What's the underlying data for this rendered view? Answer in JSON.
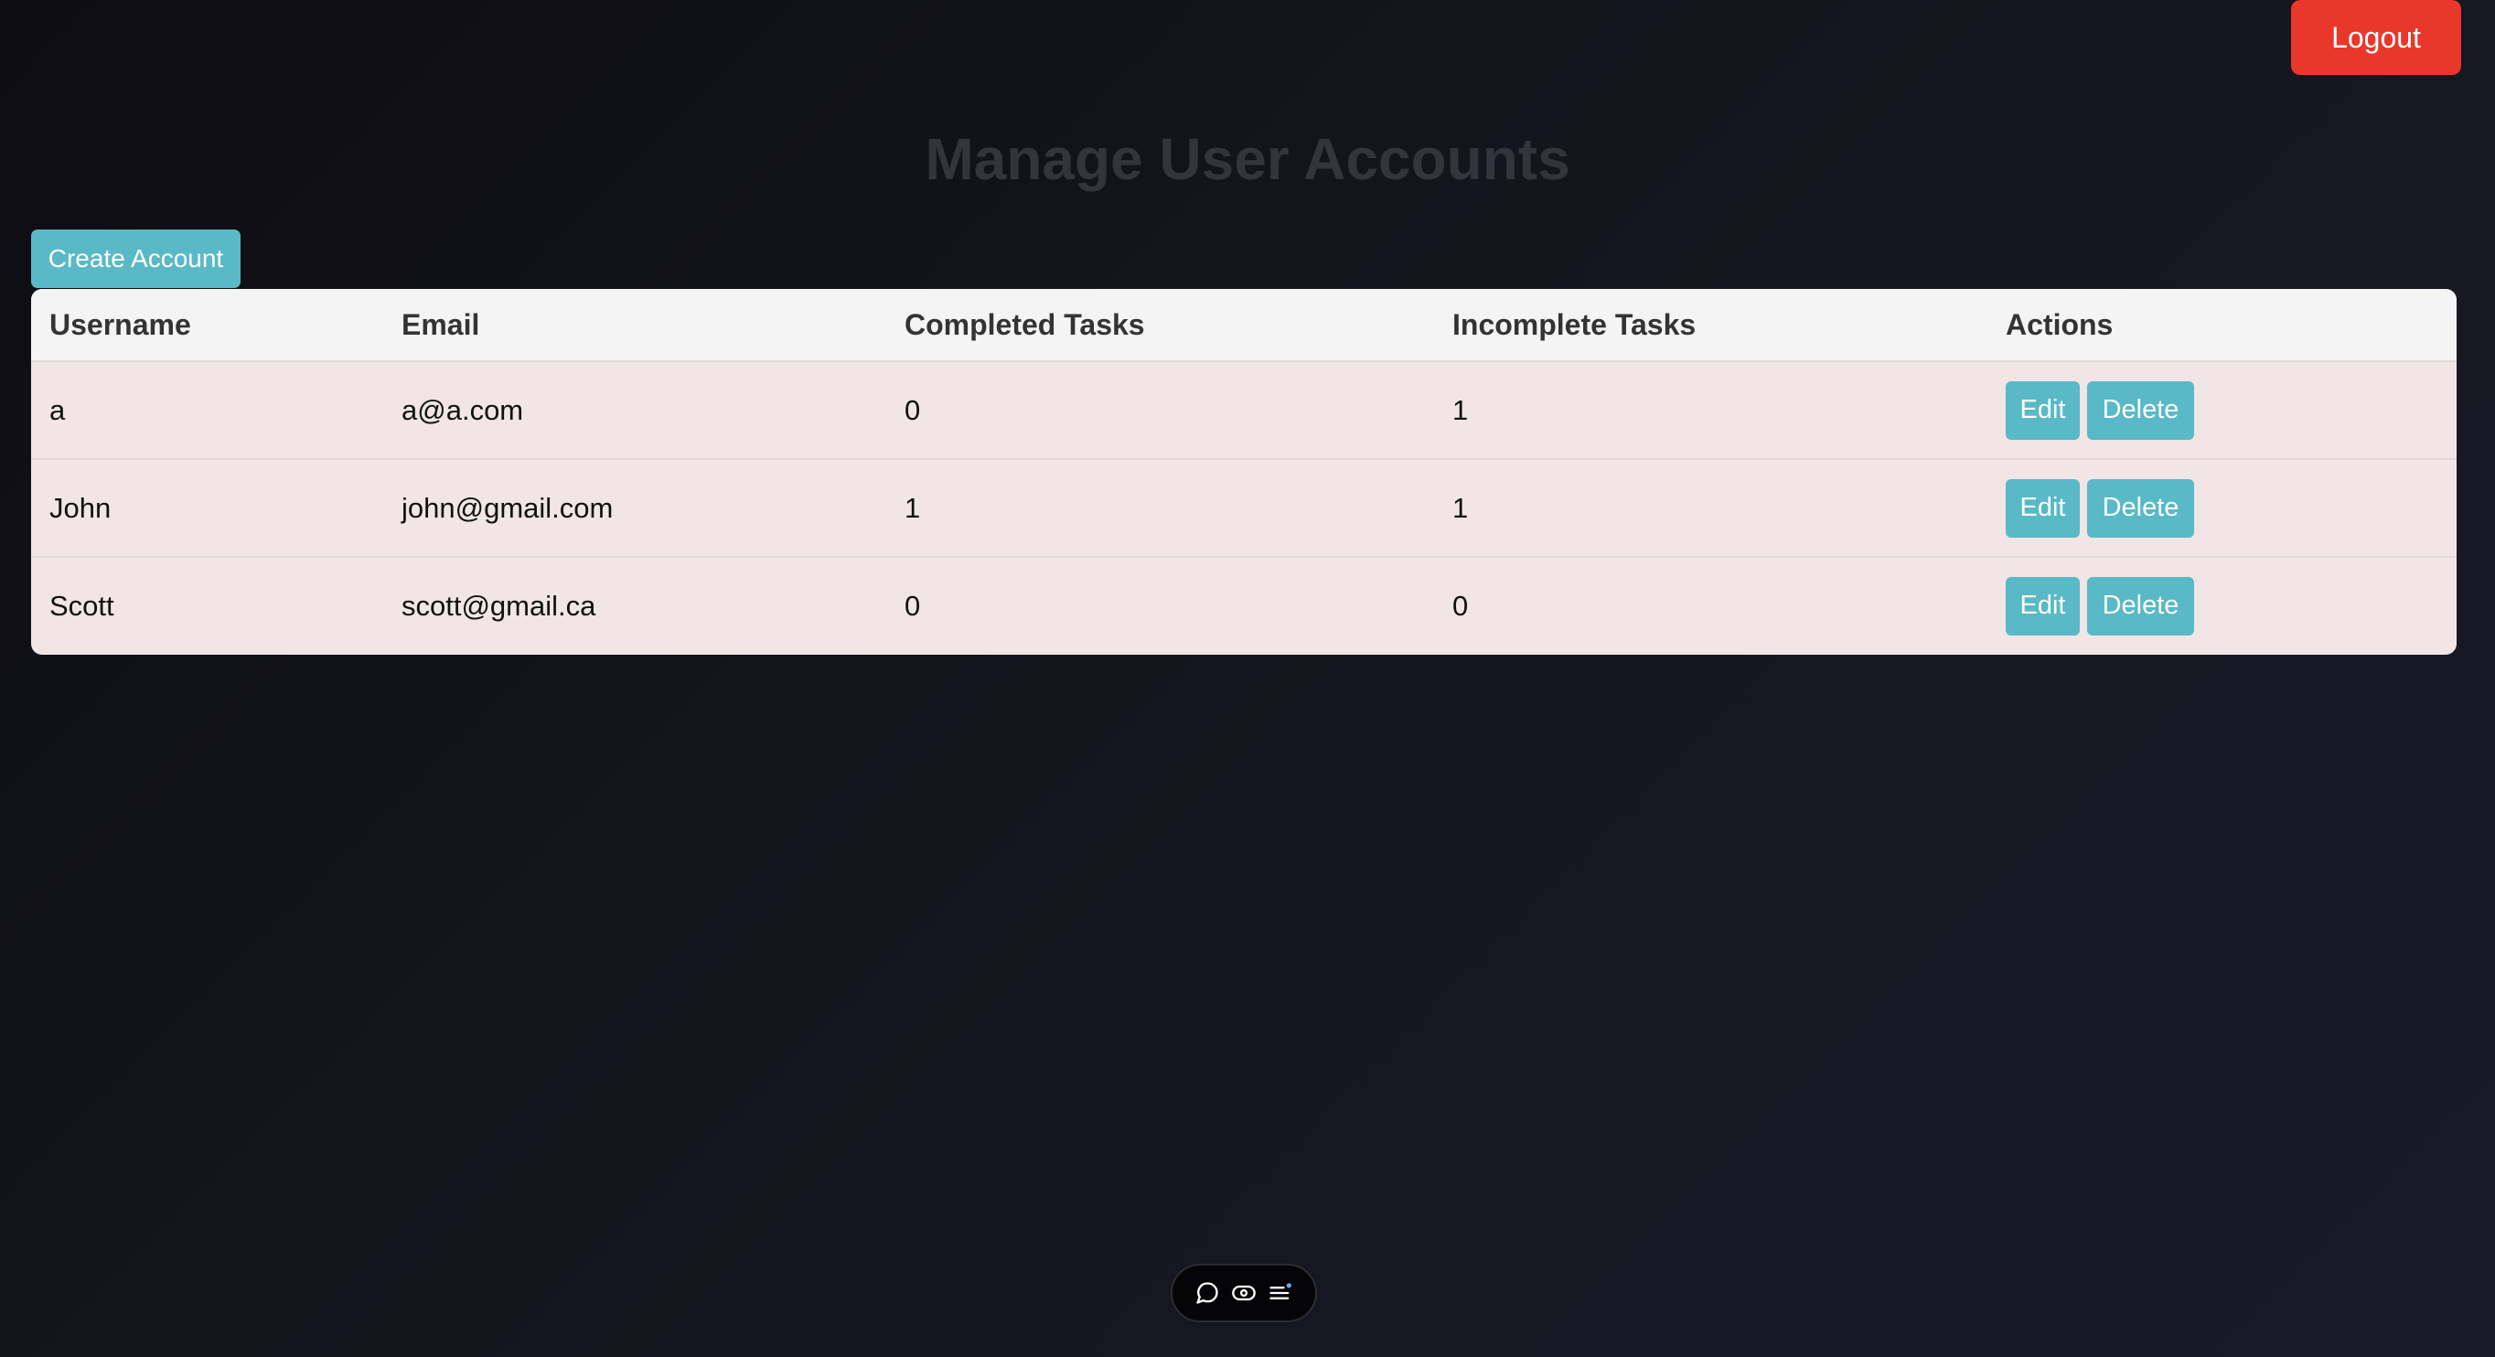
{
  "header": {
    "logout_label": "Logout",
    "title": "Manage User Accounts"
  },
  "toolbar": {
    "create_label": "Create Account"
  },
  "table": {
    "columns": [
      "Username",
      "Email",
      "Completed Tasks",
      "Incomplete Tasks",
      "Actions"
    ],
    "rows": [
      {
        "username": "a",
        "email": "a@a.com",
        "completed": "0",
        "incomplete": "1",
        "edit_label": "Edit",
        "delete_label": "Delete"
      },
      {
        "username": "John",
        "email": "john@gmail.com",
        "completed": "1",
        "incomplete": "1",
        "edit_label": "Edit",
        "delete_label": "Delete"
      },
      {
        "username": "Scott",
        "email": "scott@gmail.ca",
        "completed": "0",
        "incomplete": "0",
        "edit_label": "Edit",
        "delete_label": "Delete"
      }
    ]
  },
  "bottom_toolbar": {
    "icons": [
      "chat-bubble-icon",
      "eye-icon",
      "list-icon"
    ]
  },
  "colors": {
    "logout": "#e9372c",
    "accent": "#59b9c6",
    "row_bg": "#f1e5e5",
    "header_bg": "#f4f4f4"
  }
}
